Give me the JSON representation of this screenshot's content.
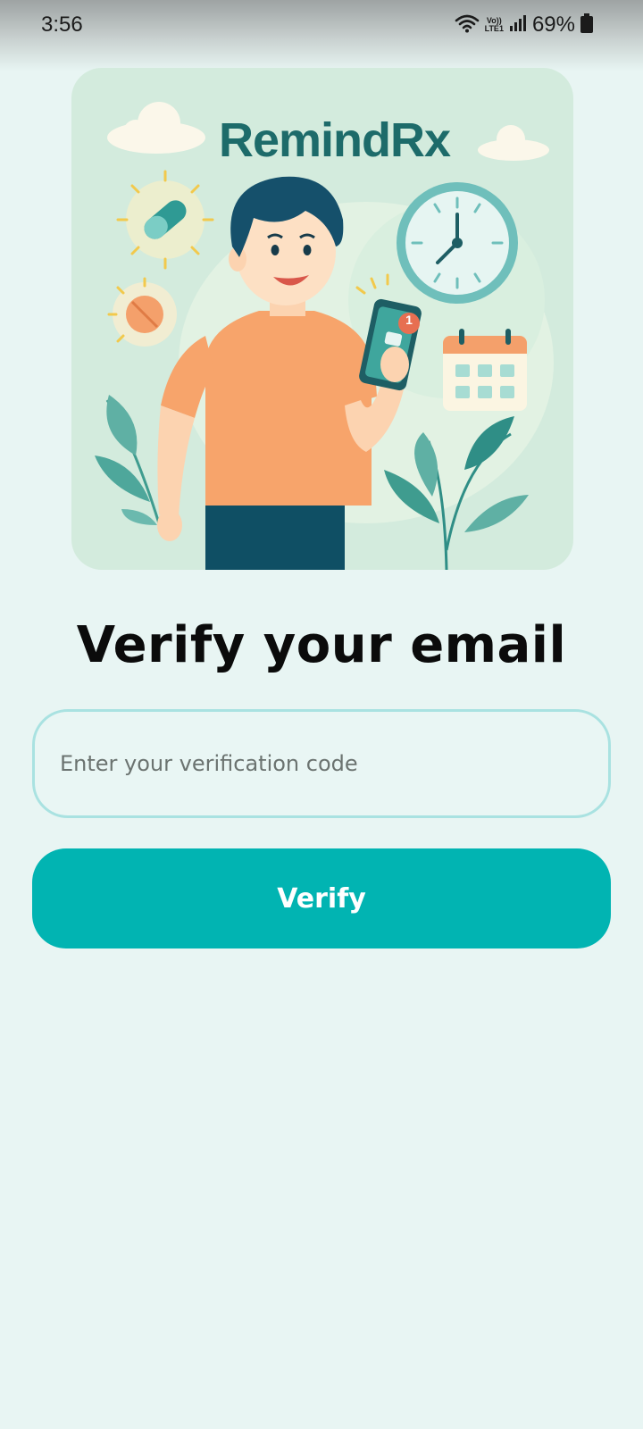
{
  "status_bar": {
    "time": "3:56",
    "volte_top": "Vo))",
    "volte_bottom": "LTE1",
    "battery": "69%",
    "icons": [
      "wifi-icon",
      "signal-icon",
      "battery-icon"
    ]
  },
  "hero": {
    "brand": "RemindRx",
    "notification_count": "1",
    "icons": [
      "capsule-icon",
      "pill-icon",
      "clock-icon",
      "calendar-icon",
      "phone-icon",
      "leaf-icon",
      "cloud-icon"
    ]
  },
  "main": {
    "title": "Verify your email",
    "code_placeholder": "Enter your verification code",
    "verify_label": "Verify"
  },
  "colors": {
    "background": "#e8f5f3",
    "accent": "#01b4b2",
    "input_border": "#a9e2e1",
    "brand_text": "#1d6b6a"
  }
}
